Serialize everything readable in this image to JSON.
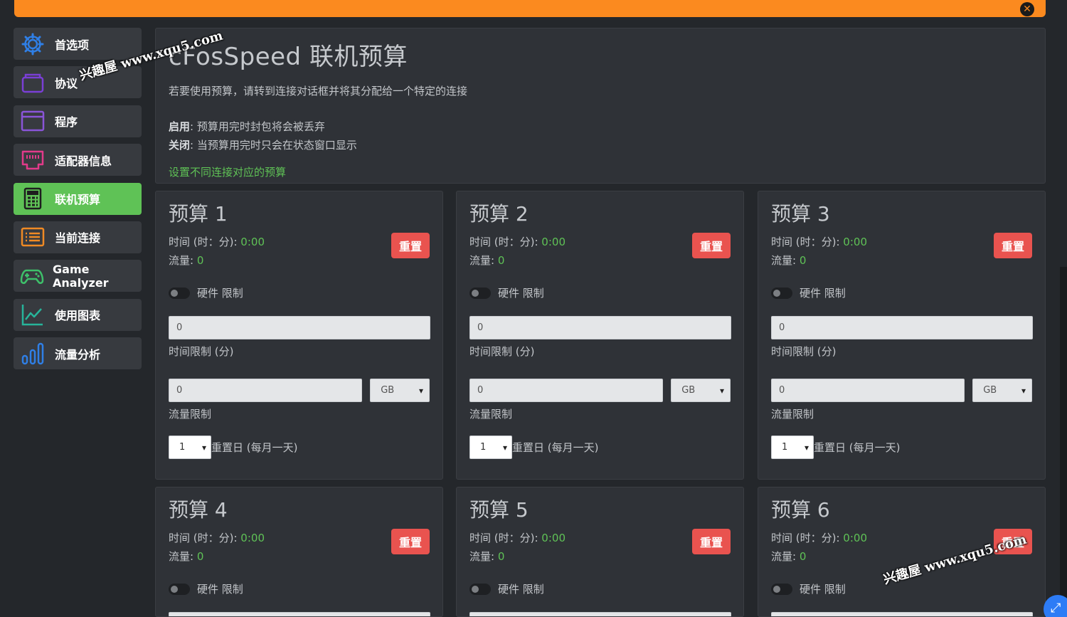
{
  "page": {
    "title": "cFosSpeed 联机预算",
    "description": "若要使用预算，请转到连接对话框并将其分配给一个特定的连接",
    "enable_term": "启用",
    "enable_text": ": 预算用完时封包将会被丢弃",
    "disable_term": "关闭",
    "disable_text": ": 当预算用完时只会在状态窗口显示",
    "link": "设置不同连接对应的预算"
  },
  "sidebar": {
    "items": [
      {
        "label": "首选项",
        "icon": "gear-icon",
        "color": "#2f7fe6"
      },
      {
        "label": "协议",
        "icon": "protocol-icon",
        "color": "#7a3fd6"
      },
      {
        "label": "程序",
        "icon": "window-icon",
        "color": "#8a55d8"
      },
      {
        "label": "适配器信息",
        "icon": "ethernet-icon",
        "color": "#e23a8a"
      },
      {
        "label": "联机预算",
        "icon": "calculator-icon",
        "color": "#1e1e1e"
      },
      {
        "label": "当前连接",
        "icon": "list-icon",
        "color": "#f08a24"
      },
      {
        "label": "Game Analyzer",
        "icon": "gamepad-icon",
        "color": "#3ec06a"
      },
      {
        "label": "使用图表",
        "icon": "line-chart-icon",
        "color": "#27b49a"
      },
      {
        "label": "流量分析",
        "icon": "bar-chart-icon",
        "color": "#2f7fe6"
      }
    ]
  },
  "card_common": {
    "time_label": "时间 (时：分): ",
    "traffic_label": "流量: ",
    "reset_label": "重置",
    "hard_limit_label": "硬件 限制",
    "time_limit_label": "时间限制 (分)",
    "traffic_limit_label": "流量限制",
    "reset_day_label": "重置日 (每月一天)"
  },
  "budgets": [
    {
      "title": "预算 1",
      "time": "0:00",
      "traffic": "0",
      "time_limit": "0",
      "traffic_limit": "0",
      "unit": "GB",
      "reset_day": "1"
    },
    {
      "title": "预算 2",
      "time": "0:00",
      "traffic": "0",
      "time_limit": "0",
      "traffic_limit": "0",
      "unit": "GB",
      "reset_day": "1"
    },
    {
      "title": "预算 3",
      "time": "0:00",
      "traffic": "0",
      "time_limit": "0",
      "traffic_limit": "0",
      "unit": "GB",
      "reset_day": "1"
    },
    {
      "title": "预算 4",
      "time": "0:00",
      "traffic": "0"
    },
    {
      "title": "预算 5",
      "time": "0:00",
      "traffic": "0"
    },
    {
      "title": "预算 6",
      "time": "0:00",
      "traffic": "0"
    }
  ],
  "watermark": {
    "text": "兴趣屋 www.xqu5.com"
  },
  "colors": {
    "accent_orange": "#fb8a1f",
    "active_green": "#5fc256",
    "reset_red": "#e9534f",
    "value_green": "#5fc256"
  }
}
